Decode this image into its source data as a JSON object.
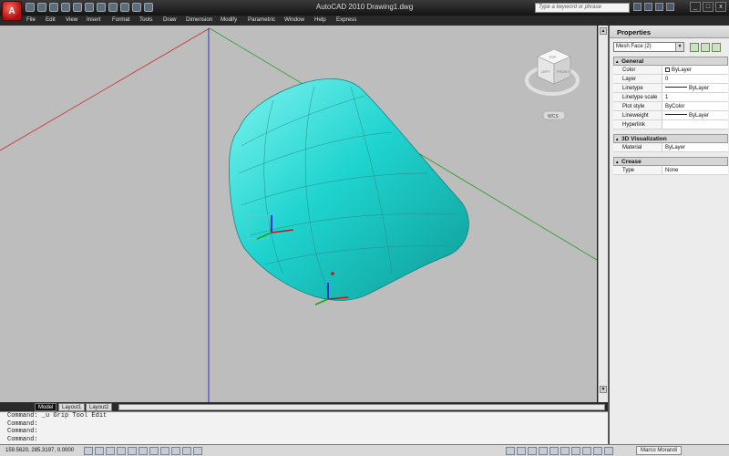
{
  "window": {
    "title": "AutoCAD 2010    Drawing1.dwg",
    "app_logo": "A",
    "search_placeholder": "Type a keyword or phrase",
    "controls": {
      "minimize": "_",
      "maximize": "□",
      "close": "x"
    }
  },
  "menu": [
    "File",
    "Edit",
    "View",
    "Insert",
    "Format",
    "Tools",
    "Draw",
    "Dimension",
    "Modify",
    "Parametric",
    "Window",
    "Help",
    "Express"
  ],
  "viewcube": {
    "top_label": "TOP",
    "left_label": "LEFT",
    "right_label": "FRONT",
    "wcs_label": "WCS"
  },
  "layout_tabs": [
    "Model",
    "Layout1",
    "Layout2"
  ],
  "command_lines": [
    "Command: _u Grip Tool Edit",
    "Command:",
    "Command:",
    "Command:"
  ],
  "status": {
    "coordinates": "159.5620, 285.3197, 0.0000",
    "user": "Marco Morandi"
  },
  "properties": {
    "header": "Properties",
    "selected_object": "Mesh Face (2)",
    "sections": [
      {
        "title": "General",
        "rows": [
          {
            "name": "Color",
            "value": "ByLayer"
          },
          {
            "name": "Layer",
            "value": "0"
          },
          {
            "name": "Linetype",
            "value": "ByLayer"
          },
          {
            "name": "Linetype scale",
            "value": "1"
          },
          {
            "name": "Plot style",
            "value": "ByColor"
          },
          {
            "name": "Lineweight",
            "value": "ByLayer"
          },
          {
            "name": "Hyperlink",
            "value": ""
          }
        ]
      },
      {
        "title": "3D Visualization",
        "rows": [
          {
            "name": "Material",
            "value": "ByLayer"
          }
        ]
      },
      {
        "title": "Crease",
        "rows": [
          {
            "name": "Type",
            "value": "None"
          }
        ]
      }
    ]
  },
  "colors": {
    "mesh_fill": "#1fd4cf",
    "viewport_bg": "#bdbdbd",
    "axis_x": "#d01010",
    "axis_y": "#18a818",
    "axis_z": "#1010d0"
  }
}
